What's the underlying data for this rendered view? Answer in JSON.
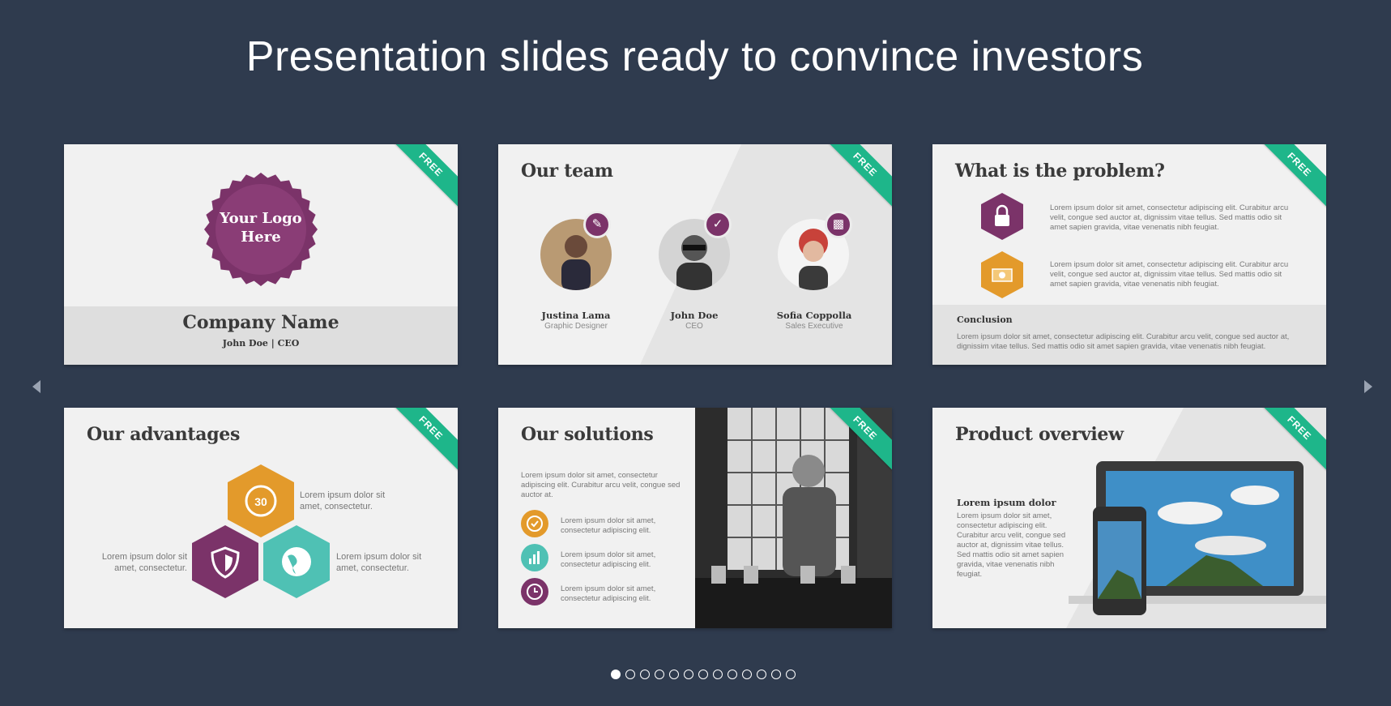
{
  "header": {
    "title": "Presentation slides ready to convince investors"
  },
  "colors": {
    "background": "#2f3b4e",
    "ribbon": "#1eb68a",
    "purple": "#7b3369",
    "orange": "#e39a2b",
    "teal": "#4fc1b4"
  },
  "ribbon_label": "FREE",
  "slides": [
    {
      "logo_text": "Your Logo Here",
      "company": "Company Name",
      "role": "John Doe | CEO"
    },
    {
      "title": "Our team",
      "members": [
        {
          "name": "Justina Lama",
          "role": "Graphic Designer",
          "icon": "pencil-icon"
        },
        {
          "name": "John Doe",
          "role": "CEO",
          "icon": "check-icon"
        },
        {
          "name": "Sofia Coppolla",
          "role": "Sales Executive",
          "icon": "chart-icon"
        }
      ]
    },
    {
      "title": "What is the problem?",
      "points": [
        {
          "icon": "lock-icon",
          "text": "Lorem ipsum dolor sit amet, consectetur adipiscing elit. Curabitur arcu velit, congue sed auctor at, dignissim vitae tellus. Sed mattis odio sit amet sapien gravida, vitae venenatis nibh feugiat."
        },
        {
          "icon": "money-icon",
          "text": "Lorem ipsum dolor sit amet, consectetur adipiscing elit. Curabitur arcu velit, congue sed auctor at, dignissim vitae tellus. Sed mattis odio sit amet sapien gravida, vitae venenatis nibh feugiat."
        }
      ],
      "conclusion_title": "Conclusion",
      "conclusion_text": "Lorem ipsum dolor sit amet, consectetur adipiscing elit. Curabitur arcu velit, congue sed auctor at, dignissim vitae tellus. Sed mattis odio sit amet sapien gravida, vitae venenatis nibh feugiat."
    },
    {
      "title": "Our advantages",
      "hex_number": "30",
      "labels": [
        "Lorem ipsum dolor sit amet, consectetur.",
        "Lorem ipsum dolor sit amet, consectetur.",
        "Lorem ipsum dolor sit amet, consectetur."
      ]
    },
    {
      "title": "Our solutions",
      "intro": "Lorem ipsum dolor sit amet, consectetur adipiscing elit. Curabitur arcu velit, congue sed auctor at.",
      "items": [
        "Lorem ipsum dolor sit amet, consectetur adipiscing elit.",
        "Lorem ipsum dolor sit amet, consectetur adipiscing elit.",
        "Lorem ipsum dolor sit amet, consectetur adipiscing elit."
      ]
    },
    {
      "title": "Product overview",
      "subtitle": "Lorem ipsum dolor",
      "body": "Lorem ipsum dolor sit amet, consectetur adipiscing elit. Curabitur arcu velit, congue sed auctor at, dignissim vitae tellus. Sed mattis odio sit amet sapien gravida, vitae venenatis nibh feugiat."
    }
  ],
  "pagination": {
    "total": 13,
    "active": 0
  }
}
